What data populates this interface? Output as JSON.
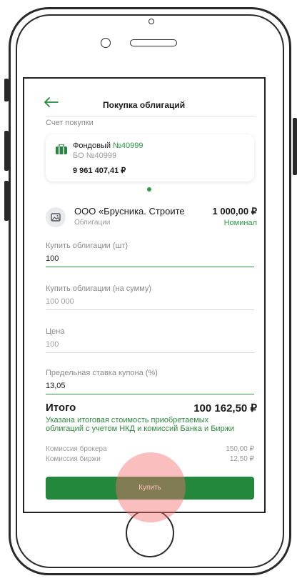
{
  "header": {
    "back_icon": "arrow-left-icon",
    "title": "Покупка облигаций"
  },
  "account": {
    "section_label": "Счет покупки",
    "icon": "wallet-icon",
    "name": "Фондовый",
    "number": "№40999",
    "sub": "БО №40999",
    "balance": "9 961 407,41 ₽"
  },
  "bond": {
    "icon": "image-icon",
    "name": "ООО «Брусника. Строите",
    "type": "Облигации",
    "price": "1 000,00 ₽",
    "price_label": "Номинал"
  },
  "fields": {
    "quantity": {
      "label": "Купить облигации (шт)",
      "value": "100"
    },
    "amount": {
      "label": "Купить облигации (на сумму)",
      "value": "100 000"
    },
    "price": {
      "label": "Цена",
      "value": "100"
    },
    "coupon": {
      "label": "Предельная ставка купона (%)",
      "value": "13,05"
    }
  },
  "total": {
    "label": "Итого",
    "value": "100 162,50 ₽",
    "note": "Указана итоговая стоимость приобретаемых облигаций с учетом НКД и комиссий Банка и Биржи"
  },
  "fees": [
    {
      "label": "Комиссия брокера",
      "value": "150,00 ₽"
    },
    {
      "label": "Комиссия биржи",
      "value": "12,50 ₽"
    }
  ],
  "buy_button": {
    "label": "Купить"
  },
  "colors": {
    "accent": "#2e9a44",
    "button": "#24883c",
    "touch": "#f56e6e"
  }
}
